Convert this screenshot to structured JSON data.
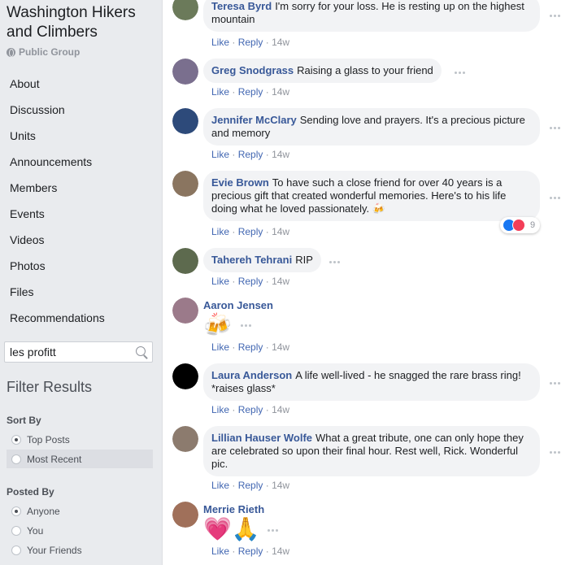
{
  "group": {
    "title": "Washington Hikers and Climbers",
    "privacy": "Public Group"
  },
  "nav": [
    "About",
    "Discussion",
    "Units",
    "Announcements",
    "Members",
    "Events",
    "Videos",
    "Photos",
    "Files",
    "Recommendations"
  ],
  "search": {
    "value": "les profitt"
  },
  "filter": {
    "title": "Filter Results",
    "sort_by": {
      "label": "Sort By",
      "options": [
        {
          "label": "Top Posts",
          "selected": true
        },
        {
          "label": "Most Recent",
          "selected": false
        }
      ]
    },
    "posted_by": {
      "label": "Posted By",
      "options": [
        {
          "label": "Anyone",
          "selected": true
        },
        {
          "label": "You",
          "selected": false
        },
        {
          "label": "Your Friends",
          "selected": false
        }
      ]
    }
  },
  "action_labels": {
    "like": "Like",
    "reply": "Reply",
    "sep": "·"
  },
  "comments": [
    {
      "author": "Teresa Byrd",
      "text": "I'm sorry for your loss. He is resting up on the highest mountain",
      "time": "14w",
      "avatar_color": "#6b7a5a"
    },
    {
      "author": "Greg Snodgrass",
      "text": "Raising a glass to your friend",
      "time": "14w",
      "avatar_color": "#7a6f8e"
    },
    {
      "author": "Jennifer McClary",
      "text": "Sending love and prayers. It's a precious picture and memory",
      "time": "14w",
      "avatar_color": "#2d4a7a"
    },
    {
      "author": "Evie Brown",
      "text": "To have such a close friend for over 40 years is a precious gift that created wonderful memories. Here's to his life doing what he loved passionately.",
      "emoji": "🍻",
      "time": "14w",
      "reactions": "9",
      "avatar_color": "#8a7560"
    },
    {
      "author": "Tahereh Tehrani",
      "text": "RIP",
      "time": "14w",
      "avatar_color": "#5d6a4e"
    },
    {
      "author": "Aaron Jensen",
      "text": "",
      "emoji": "🍻",
      "time": "14w",
      "avatar_color": "#9b7a8a"
    },
    {
      "author": "Laura Anderson",
      "text": "A life well-lived - he snagged the rare brass ring! *raises glass*",
      "time": "14w",
      "avatar_color": "#000000"
    },
    {
      "author": "Lillian Hauser Wolfe",
      "text": "What a great tribute, one can only hope they are celebrated so upon their final hour. Rest well, Rick. Wonderful pic.",
      "time": "14w",
      "avatar_color": "#8c7b6e"
    },
    {
      "author": "Merrie Rieth",
      "text": "",
      "emoji": "💗🙏",
      "time": "14w",
      "avatar_color": "#a0705a"
    }
  ]
}
